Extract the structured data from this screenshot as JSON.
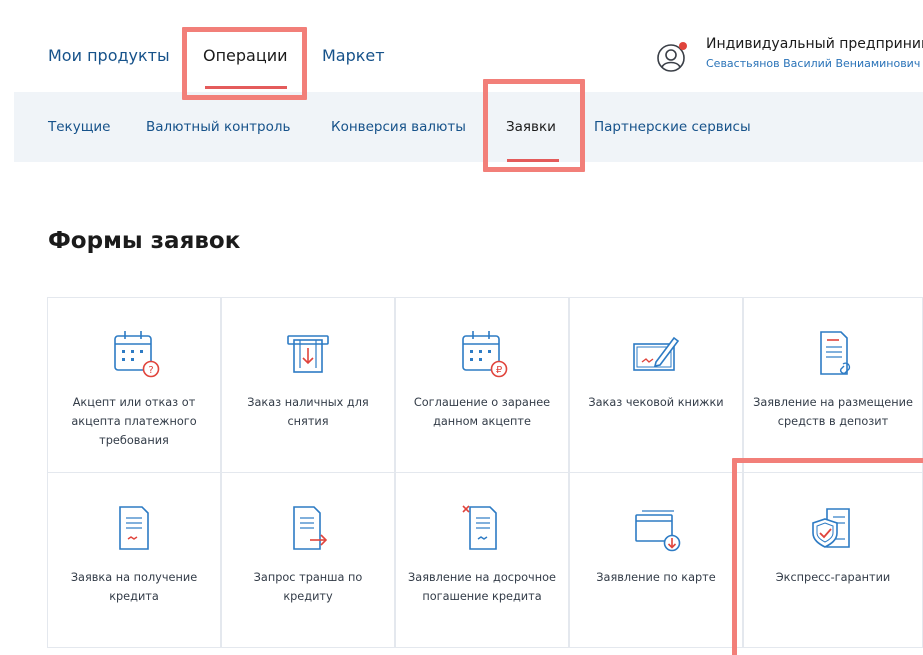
{
  "top_nav": {
    "tabs": [
      "Мои продукты",
      "Операции",
      "Маркет"
    ],
    "active": "Операции"
  },
  "user": {
    "org": "Индивидуальный предпринимат",
    "name": "Севастьянов Василий Вениаминович",
    "icon": "user-avatar-icon"
  },
  "sub_nav": {
    "tabs": [
      "Текущие",
      "Валютный контроль",
      "Конверсия валюты",
      "Заявки",
      "Партнерские сервисы"
    ],
    "active": "Заявки"
  },
  "section": {
    "title": "Формы заявок"
  },
  "cards": [
    {
      "label": "Акцепт или отказ от акцепта платежного требования",
      "icon": "calendar-question-icon"
    },
    {
      "label": "Заказ наличных для снятия",
      "icon": "atm-cash-icon"
    },
    {
      "label": "Соглашение о заранее данном акцепте",
      "icon": "calendar-ruble-icon"
    },
    {
      "label": "Заказ чековой книжки",
      "icon": "checkbook-pen-icon"
    },
    {
      "label": "Заявление на размещение средств в депозит",
      "icon": "document-clip-icon"
    },
    {
      "label": "Заявка на получение кредита",
      "icon": "document-signature-icon"
    },
    {
      "label": "Запрос транша по кредиту",
      "icon": "document-arrow-icon"
    },
    {
      "label": "Заявление на досрочное погашение кредита",
      "icon": "document-cross-icon"
    },
    {
      "label": "Заявление по карте",
      "icon": "card-download-icon"
    },
    {
      "label": "Экспресс-гарантии",
      "icon": "shield-document-icon"
    }
  ],
  "colors": {
    "accent": "#e45b5b",
    "link": "#16528a",
    "highlight": "#f27f79",
    "icon_blue": "#2d7bc4",
    "icon_red": "#e0443c"
  }
}
